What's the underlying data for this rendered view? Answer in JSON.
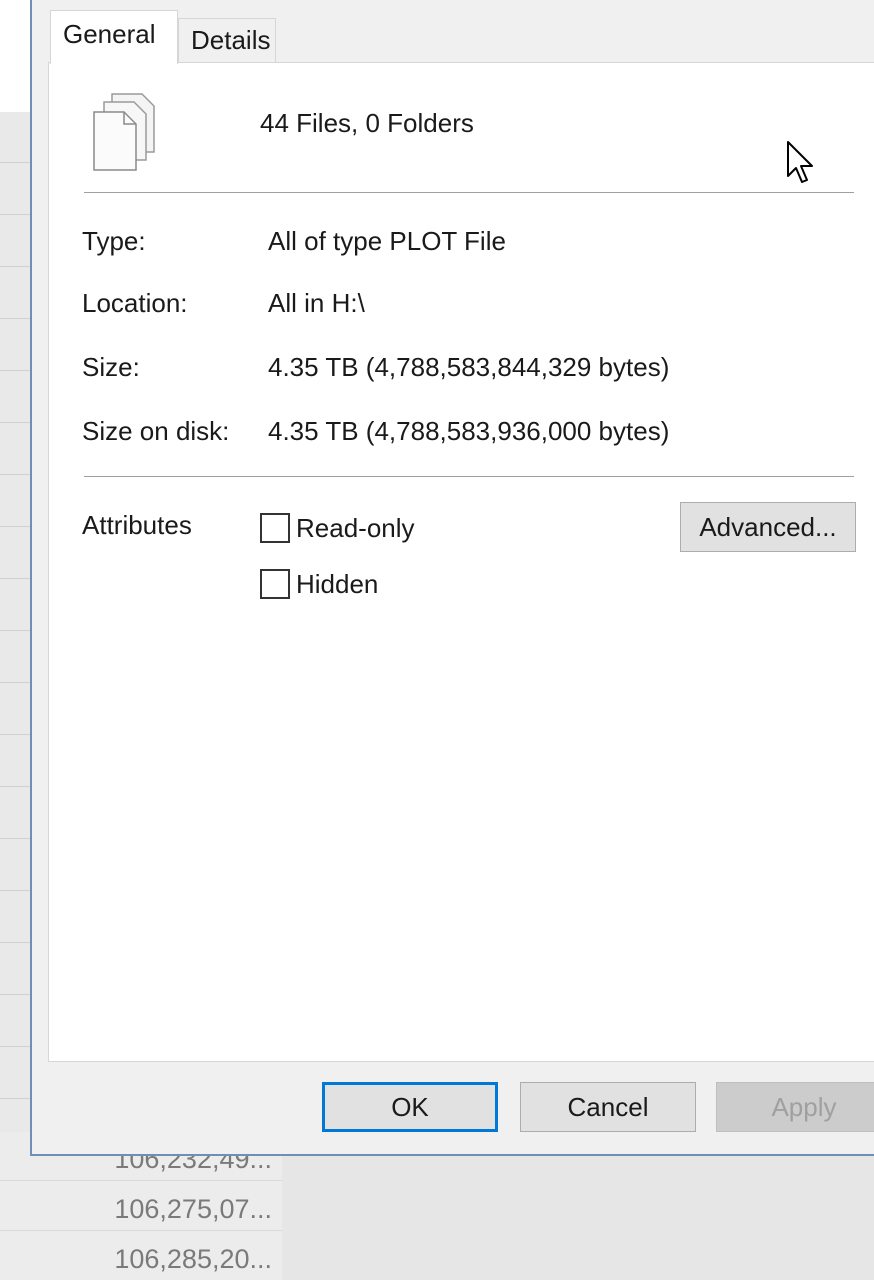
{
  "tabs": [
    {
      "label": "General",
      "active": true
    },
    {
      "label": "Details",
      "active": false
    }
  ],
  "summary": "44 Files, 0 Folders",
  "properties": [
    {
      "label": "Type:",
      "value": "All of type PLOT File"
    },
    {
      "label": "Location:",
      "value": "All in H:\\"
    },
    {
      "label": "Size:",
      "value": "4.35 TB (4,788,583,844,329 bytes)"
    },
    {
      "label": "Size on disk:",
      "value": "4.35 TB (4,788,583,936,000 bytes)"
    }
  ],
  "attributes": {
    "label": "Attributes",
    "read_only": {
      "label": "Read-only",
      "checked": false
    },
    "hidden": {
      "label": "Hidden",
      "checked": false
    },
    "advanced_label": "Advanced..."
  },
  "buttons": {
    "ok": "OK",
    "cancel": "Cancel",
    "apply": "Apply"
  },
  "background_list": {
    "values": [
      "106,232,49...",
      "106,275,07...",
      "106,285,20..."
    ]
  },
  "icons": {
    "files": "multiple-files-icon",
    "cursor": "mouse-pointer-icon"
  },
  "colors": {
    "focus_border": "#0078d7",
    "dialog_bg": "#f0f0f0",
    "panel_bg": "#ffffff"
  }
}
